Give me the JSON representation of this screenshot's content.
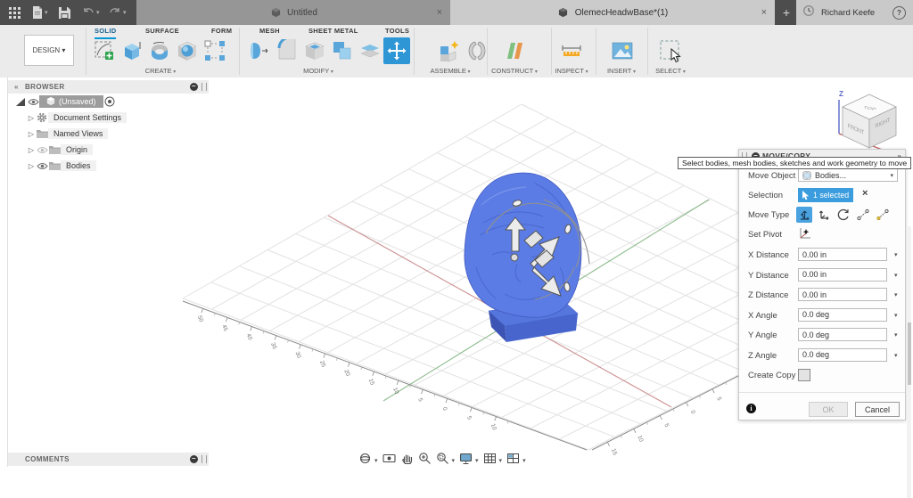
{
  "titlebar": {
    "tabs": [
      {
        "label": "Untitled"
      },
      {
        "label": "OlemecHeadwBase*(1)"
      }
    ],
    "close_glyph": "×",
    "new_tab": "+",
    "user": "Richard Keefe",
    "help": "?"
  },
  "ribbon": {
    "design_label": "DESIGN ▾",
    "tabs": [
      "SOLID",
      "SURFACE",
      "FORM",
      "MESH",
      "SHEET METAL",
      "TOOLS"
    ],
    "active_tab": "SOLID",
    "groups": [
      "CREATE",
      "MODIFY",
      "ASSEMBLE",
      "CONSTRUCT",
      "INSPECT",
      "INSERT",
      "SELECT"
    ],
    "accent": "#0696d7"
  },
  "browser": {
    "title": "BROWSER",
    "root_label": "(Unsaved)",
    "items": [
      "Document Settings",
      "Named Views",
      "Origin",
      "Bodies"
    ]
  },
  "comments": {
    "title": "COMMENTS"
  },
  "dialog": {
    "title": "MOVE/COPY",
    "expand_glyph": "»",
    "tooltip": "Select bodies, mesh bodies, sketches and work geometry to move",
    "move_object_label": "Move Object",
    "move_object_value": "Bodies...",
    "selection_label": "Selection",
    "selection_value": "1 selected",
    "selection_clear": "×",
    "move_type_label": "Move Type",
    "set_pivot_label": "Set Pivot",
    "fields": [
      {
        "label": "X Distance",
        "value": "0.00 in"
      },
      {
        "label": "Y Distance",
        "value": "0.00 in"
      },
      {
        "label": "Z Distance",
        "value": "0.00 in"
      },
      {
        "label": "X Angle",
        "value": "0.0 deg"
      },
      {
        "label": "Y Angle",
        "value": "0.0 deg"
      },
      {
        "label": "Z Angle",
        "value": "0.0 deg"
      }
    ],
    "create_copy_label": "Create Copy",
    "ok_label": "OK",
    "cancel_label": "Cancel",
    "selection_blue": "#3b9ddd"
  },
  "viewport": {
    "viewcube": {
      "top": "TOP",
      "front": "FRONT",
      "right": "RIGHT"
    },
    "axis_labels": {
      "z": "Z"
    },
    "rulers": {
      "left": [
        "50",
        "45",
        "40",
        "35",
        "30",
        "25",
        "20",
        "15",
        "10",
        "5",
        "0",
        "5",
        "10"
      ],
      "right": [
        "15",
        "10",
        "5",
        "0",
        "5",
        "10"
      ]
    },
    "colors": {
      "grid": "#e2e2e2",
      "ruler": "#8a8a8a",
      "axis_red": "#cc9090",
      "axis_green": "#8fbc8f",
      "model_blue": "#5b7ce4"
    }
  }
}
